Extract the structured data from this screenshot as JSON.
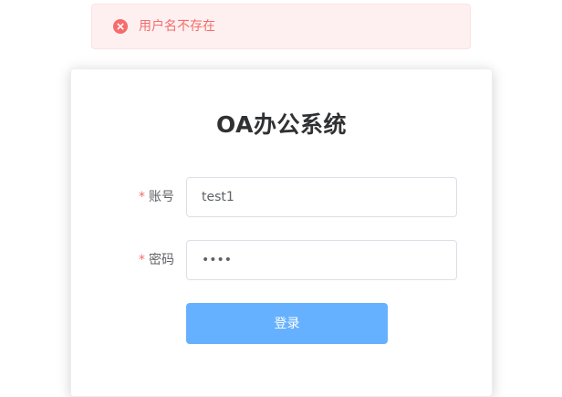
{
  "message": {
    "text": "用户名不存在",
    "icon": "error-circle-icon",
    "color": "#f56c6c"
  },
  "card": {
    "title": "OA办公系统"
  },
  "form": {
    "required_mark": "*",
    "account": {
      "label": "账号",
      "value": "test1"
    },
    "password": {
      "label": "密码",
      "value": "••••"
    },
    "submit_label": "登录"
  },
  "colors": {
    "primary_button": "#66b1ff",
    "error": "#f56c6c",
    "toast_bg": "#fef0f0"
  }
}
